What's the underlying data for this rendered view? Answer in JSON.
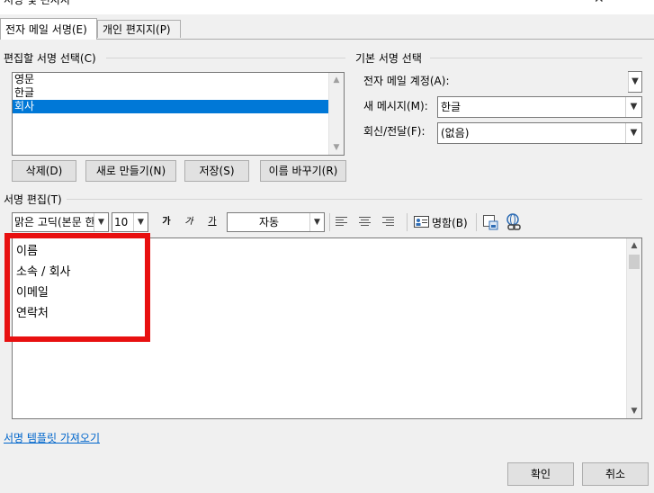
{
  "window": {
    "title": "서명 및 편지지",
    "close_glyph": "✕"
  },
  "tabs": [
    {
      "label": "전자 메일 서명(E)",
      "active": true
    },
    {
      "label": "개인 편지지(P)",
      "active": false
    }
  ],
  "edit_section": {
    "label": "편집할 서명 선택(C)",
    "items": [
      {
        "label": "영문",
        "selected": false
      },
      {
        "label": "한글",
        "selected": false
      },
      {
        "label": "회사",
        "selected": true
      }
    ],
    "buttons": {
      "delete": "삭제(D)",
      "new": "새로 만들기(N)",
      "save": "저장(S)",
      "rename": "이름 바꾸기(R)"
    }
  },
  "default_section": {
    "label": "기본 서명 선택",
    "account_label": "전자 메일 계정(A):",
    "account_value": "",
    "new_messages_label": "새 메시지(M):",
    "new_messages_value": "한글",
    "replies_label": "회신/전달(F):",
    "replies_value": "(없음)"
  },
  "editor_section": {
    "label": "서명 편집(T)",
    "font": "맑은 고딕(본문 한",
    "size": "10",
    "bold": "가",
    "italic": "가",
    "underline": "가",
    "color": "자동",
    "business_card": "명함(B)",
    "lines": [
      "이름",
      "소속 / 회사",
      "이메일",
      "연락처"
    ]
  },
  "templates_link": "서명 템플릿 가져오기",
  "footer": {
    "ok": "확인",
    "cancel": "취소"
  },
  "colors": {
    "highlight": "#e81010",
    "selection": "#0078d7",
    "link": "#0066cc"
  }
}
